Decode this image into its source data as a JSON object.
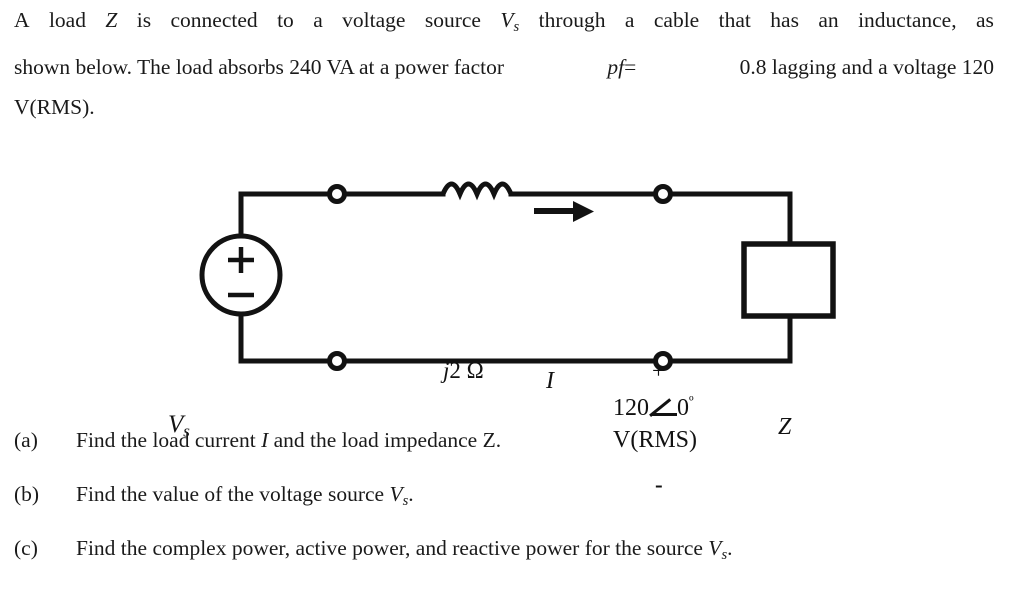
{
  "problem": {
    "line1_left": "A load",
    "line1_var": "Z",
    "line1_mid": "is connected to a voltage source",
    "line1_source_var": "V",
    "line1_source_sub": "s",
    "line1_rest": "through a cable that has an inductance, as",
    "line1_full": "A load Z is connected to a voltage source Vs through a cable that has an inductance, as",
    "line2_a": "shown below. The load absorbs 240 VA at a power factor",
    "line2_pf": "pf",
    "line2_eq": "=",
    "line2_b": "0.8 lagging and a voltage 120",
    "line3": "V(RMS)."
  },
  "circuit": {
    "source_label": "V",
    "source_label_sub": "s",
    "source_polarity_plus": "+",
    "source_polarity_minus": "−",
    "inductor_label": "j2 Ω",
    "current_label": "I",
    "terminal_plus": "+",
    "terminal_minus": "-",
    "load_voltage_magnitude": "120",
    "load_voltage_angle": "0",
    "load_voltage_degree": "º",
    "load_voltage_units": "V(RMS)",
    "load_label": "Z"
  },
  "questions": [
    {
      "tag": "(a)",
      "pre": "Find the load current",
      "var1": "I",
      "mid": "and the load impedance",
      "var2": "Z",
      "post": ".",
      "full": "Find the load current I and the load impedance Z."
    },
    {
      "tag": "(b)",
      "pre": "Find the value of the voltage source",
      "var1": "V",
      "var1_sub": "s",
      "post": ".",
      "full": "Find the value of the voltage source Vs."
    },
    {
      "tag": "(c)",
      "pre": "Find the complex power, active power, and reactive power for the source",
      "var1": "V",
      "var1_sub": "s",
      "post": ".",
      "full": "Find the complex power, active power, and reactive power for the source Vs."
    }
  ],
  "colors": {
    "ink": "#121212",
    "background": "#ffffff"
  }
}
